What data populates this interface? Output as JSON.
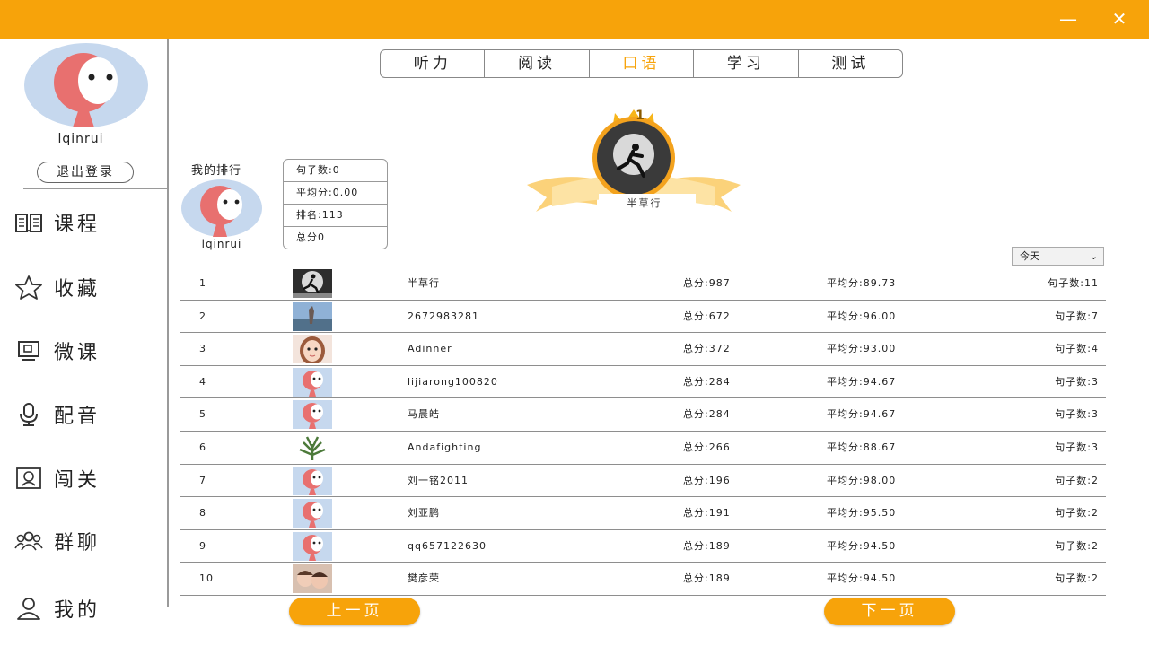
{
  "window": {
    "minimize_glyph": "—",
    "close_glyph": "✕",
    "titlebar_color": "#f7a30a"
  },
  "sidebar": {
    "username": "lqinrui",
    "logout_label": "退出登录",
    "nav": [
      {
        "label": "课程",
        "icon": "book-icon"
      },
      {
        "label": "收藏",
        "icon": "star-icon"
      },
      {
        "label": "微课",
        "icon": "screen-icon"
      },
      {
        "label": "配音",
        "icon": "microphone-icon"
      },
      {
        "label": "闯关",
        "icon": "badge-icon"
      },
      {
        "label": "群聊",
        "icon": "group-icon"
      },
      {
        "label": "我的",
        "icon": "user-icon"
      }
    ]
  },
  "tabs": [
    {
      "label": "听力",
      "active": false
    },
    {
      "label": "阅读",
      "active": false
    },
    {
      "label": "口语",
      "active": true
    },
    {
      "label": "学习",
      "active": false
    },
    {
      "label": "测试",
      "active": false
    }
  ],
  "my_rank": {
    "heading": "我的排行",
    "name": "lqinrui",
    "sentences": "句子数:0",
    "average": "平均分:0.00",
    "rank": "排名:113",
    "total": "总分0"
  },
  "top_badge": {
    "rank": "1",
    "name": "半草行"
  },
  "filter": {
    "selected": "今天"
  },
  "leaderboard": [
    {
      "rank": "1",
      "avatar": "runner",
      "name": "半草行",
      "total": "总分:987",
      "average": "平均分:89.73",
      "sentences": "句子数:11"
    },
    {
      "rank": "2",
      "avatar": "photo",
      "name": "2672983281",
      "total": "总分:672",
      "average": "平均分:96.00",
      "sentences": "句子数:7"
    },
    {
      "rank": "3",
      "avatar": "girl",
      "name": "Adinner",
      "total": "总分:372",
      "average": "平均分:93.00",
      "sentences": "句子数:4"
    },
    {
      "rank": "4",
      "avatar": "default",
      "name": "lijiarong100820",
      "total": "总分:284",
      "average": "平均分:94.67",
      "sentences": "句子数:3"
    },
    {
      "rank": "5",
      "avatar": "default",
      "name": "马晨皓",
      "total": "总分:284",
      "average": "平均分:94.67",
      "sentences": "句子数:3"
    },
    {
      "rank": "6",
      "avatar": "plant",
      "name": "Andafighting",
      "total": "总分:266",
      "average": "平均分:88.67",
      "sentences": "句子数:3"
    },
    {
      "rank": "7",
      "avatar": "default",
      "name": "刘一铭2011",
      "total": "总分:196",
      "average": "平均分:98.00",
      "sentences": "句子数:2"
    },
    {
      "rank": "8",
      "avatar": "default",
      "name": "刘亚鹏",
      "total": "总分:191",
      "average": "平均分:95.50",
      "sentences": "句子数:2"
    },
    {
      "rank": "9",
      "avatar": "default",
      "name": "qq657122630",
      "total": "总分:189",
      "average": "平均分:94.50",
      "sentences": "句子数:2"
    },
    {
      "rank": "10",
      "avatar": "kids",
      "name": "樊彦荣",
      "total": "总分:189",
      "average": "平均分:94.50",
      "sentences": "句子数:2"
    }
  ],
  "pager": {
    "prev_label": "上一页",
    "next_label": "下一页"
  }
}
